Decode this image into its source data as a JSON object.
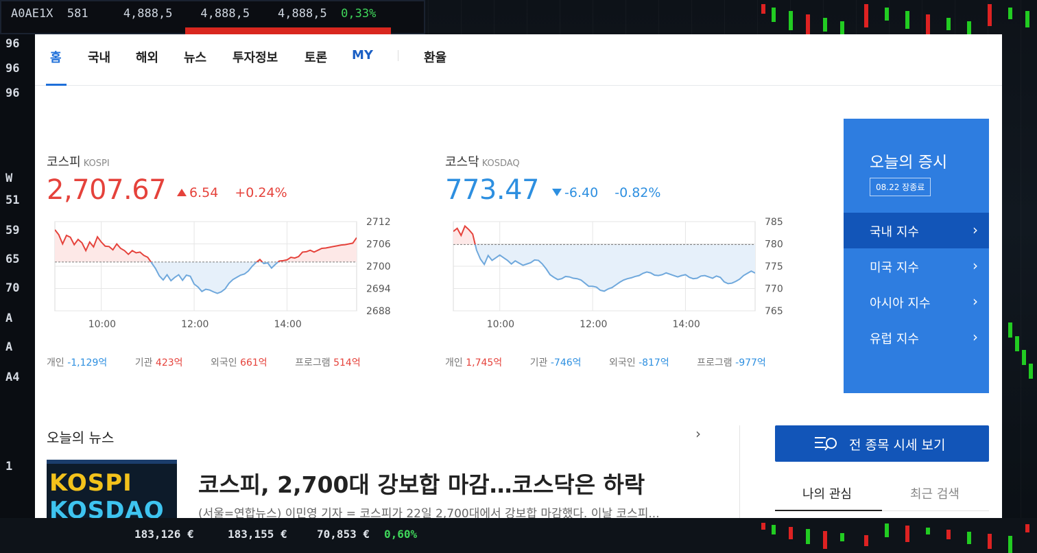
{
  "background": {
    "ticker": {
      "code": "A0AE1X",
      "num": "581",
      "v1": "4,888,5",
      "v2": "4,888,5",
      "v3": "4,888,5",
      "pct": "0,33%"
    },
    "left_labels": [
      "96",
      "96",
      "96",
      "W",
      "51",
      "59",
      "65",
      "70",
      "A",
      "A",
      "A4",
      "1"
    ],
    "bottom": [
      "183,126 €",
      "183,155 €",
      "70,853 €",
      "0,60%"
    ]
  },
  "nav": {
    "items": [
      "홈",
      "국내",
      "해외",
      "뉴스",
      "투자정보",
      "토론",
      "MY",
      "환율"
    ]
  },
  "kospi": {
    "name": "코스피",
    "name_en": "KOSPI",
    "value": "2,707.67",
    "change": "6.54",
    "change_pct": "+0.24%",
    "direction": "up",
    "investors": [
      {
        "label": "개인",
        "value": "-1,129억",
        "dir": "down"
      },
      {
        "label": "기관",
        "value": "423억",
        "dir": "up"
      },
      {
        "label": "외국인",
        "value": "661억",
        "dir": "up"
      },
      {
        "label": "프로그램",
        "value": "514억",
        "dir": "up"
      }
    ]
  },
  "kosdaq": {
    "name": "코스닥",
    "name_en": "KOSDAQ",
    "value": "773.47",
    "change": "-6.40",
    "change_pct": "-0.82%",
    "direction": "down",
    "investors": [
      {
        "label": "개인",
        "value": "1,745억",
        "dir": "up"
      },
      {
        "label": "기관",
        "value": "-746억",
        "dir": "down"
      },
      {
        "label": "외국인",
        "value": "-817억",
        "dir": "down"
      },
      {
        "label": "프로그램",
        "value": "-977억",
        "dir": "down"
      }
    ]
  },
  "chart_data": [
    {
      "type": "line",
      "name": "KOSPI intraday",
      "x_ticks": [
        "10:00",
        "12:00",
        "14:00"
      ],
      "y_ticks": [
        2712,
        2706,
        2700,
        2694,
        2688
      ],
      "ylim": [
        2688,
        2712
      ],
      "baseline": 2701.13,
      "x_minutes": [
        0,
        5,
        10,
        15,
        20,
        25,
        30,
        35,
        40,
        45,
        50,
        55,
        60,
        65,
        70,
        75,
        80,
        85,
        90,
        95,
        100,
        105,
        110,
        115,
        120,
        125,
        130,
        135,
        140,
        145,
        150,
        155,
        160,
        165,
        170,
        175,
        180,
        185,
        190,
        195,
        200,
        205,
        210,
        215,
        220,
        225,
        230,
        235,
        240,
        245,
        250,
        255,
        260,
        265,
        270,
        275,
        280,
        285,
        290,
        295,
        300,
        305,
        310,
        315,
        320,
        325,
        330,
        335,
        340,
        345,
        350,
        355,
        360,
        365,
        370,
        375,
        380,
        385,
        390
      ],
      "values": [
        2709.8,
        2708.5,
        2706,
        2708.3,
        2707.8,
        2705.8,
        2707.2,
        2706.3,
        2704.2,
        2706.5,
        2705.2,
        2707.9,
        2706.5,
        2705.4,
        2705.3,
        2704.4,
        2706,
        2704.8,
        2704.2,
        2703.2,
        2704.2,
        2703.6,
        2703.8,
        2702.9,
        2702.4,
        2700.9,
        2699.4,
        2697.4,
        2696.3,
        2697.7,
        2696.1,
        2697,
        2697.7,
        2696.2,
        2697.6,
        2697.3,
        2695.2,
        2694.4,
        2693.2,
        2693.8,
        2693.6,
        2693.1,
        2692.7,
        2693.1,
        2693.9,
        2695.4,
        2696.4,
        2697,
        2697.6,
        2697.9,
        2698.7,
        2700,
        2701,
        2701.8,
        2700.7,
        2700.9,
        2699.5,
        2700.5,
        2701.4,
        2701.5,
        2701.7,
        2702.4,
        2702.2,
        2702.6,
        2703.8,
        2703.9,
        2704.3,
        2703.8,
        2704.3,
        2704.8,
        2704.9,
        2705.1,
        2705.3,
        2705.5,
        2705.7,
        2705.8,
        2706,
        2706.2,
        2707.67
      ],
      "color_up": "#e5423b",
      "color_down": "#6fa8dc"
    },
    {
      "type": "line",
      "name": "KOSDAQ intraday",
      "x_ticks": [
        "10:00",
        "12:00",
        "14:00"
      ],
      "y_ticks": [
        785,
        780,
        775,
        770,
        765
      ],
      "ylim": [
        765,
        785
      ],
      "baseline": 779.87,
      "x_minutes": [
        0,
        5,
        10,
        15,
        20,
        25,
        30,
        35,
        40,
        45,
        50,
        55,
        60,
        65,
        70,
        75,
        80,
        85,
        90,
        95,
        100,
        105,
        110,
        115,
        120,
        125,
        130,
        135,
        140,
        145,
        150,
        155,
        160,
        165,
        170,
        175,
        180,
        185,
        190,
        195,
        200,
        205,
        210,
        215,
        220,
        225,
        230,
        235,
        240,
        245,
        250,
        255,
        260,
        265,
        270,
        275,
        280,
        285,
        290,
        295,
        300,
        305,
        310,
        315,
        320,
        325,
        330,
        335,
        340,
        345,
        350,
        355,
        360,
        365,
        370,
        375,
        380,
        385,
        390
      ],
      "values": [
        782.8,
        783.5,
        781.9,
        784,
        783.2,
        782.2,
        778.6,
        776.6,
        775.4,
        777.4,
        776.3,
        776.9,
        777.5,
        776.9,
        776.3,
        775.5,
        776.2,
        775.7,
        775.2,
        775.5,
        775.8,
        776.4,
        776.3,
        775.5,
        774.4,
        773.1,
        772.5,
        772,
        772.2,
        772.7,
        772.6,
        772.3,
        772.2,
        771.9,
        771.2,
        770.5,
        770.5,
        770.3,
        769.6,
        769.4,
        769.9,
        770.2,
        770.8,
        771.4,
        771.9,
        772.2,
        772.4,
        772.7,
        772.9,
        773.4,
        773.7,
        773.5,
        773,
        772.9,
        773.1,
        773.5,
        773.2,
        772.9,
        772.6,
        772.9,
        773.1,
        772.5,
        772.2,
        772.3,
        772.8,
        772.9,
        772.6,
        772.3,
        772.8,
        772.5,
        771.5,
        771.1,
        771.2,
        771.6,
        772.1,
        772.9,
        773.4,
        773.9,
        773.47
      ],
      "color_up": "#e5423b",
      "color_down": "#6fa8dc"
    }
  ],
  "market_box": {
    "title": "오늘의 증시",
    "date_badge": "08.22 장종료",
    "items": [
      "국내 지수",
      "미국 지수",
      "아시아 지수",
      "유럽 지수"
    ],
    "chevron": "›"
  },
  "news": {
    "section_title": "오늘의 뉴스",
    "chevron": "›",
    "thumb_line1": "KOSPI",
    "thumb_line2": "KOSDAQ",
    "headline": "코스피, 2,700대 강보합 마감…코스닥은 하락",
    "summary": "(서울=연합뉴스) 이민영 기자 = 코스피가 22일 2,700대에서 강보합 마감했다. 이날 코스피..."
  },
  "all_quotes_button": {
    "label": "전 종목 시세 보기"
  },
  "tabs": {
    "watchlist": "나의 관심",
    "recent": "최근 검색"
  },
  "colors": {
    "up": "#e5423b",
    "down": "#2d8fe0",
    "accent": "#1e6fd9",
    "box": "#2e7de0",
    "box_active": "#1255b8"
  }
}
